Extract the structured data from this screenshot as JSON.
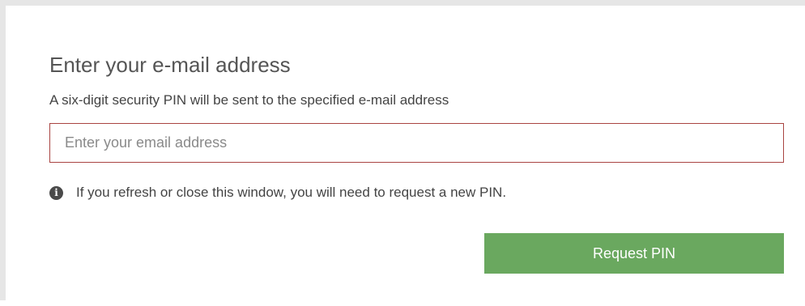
{
  "form": {
    "title": "Enter your e-mail address",
    "subtitle": "A six-digit security PIN will be sent to the specified e-mail address",
    "email": {
      "value": "",
      "placeholder": "Enter your email address",
      "border_color": "#a94442"
    },
    "notice": {
      "icon": "info-circle-icon",
      "icon_glyph": "i",
      "text": "If you refresh or close this window, you will need to request a new PIN."
    },
    "request_button": {
      "label": "Request PIN",
      "color": "#6aa85f"
    }
  }
}
